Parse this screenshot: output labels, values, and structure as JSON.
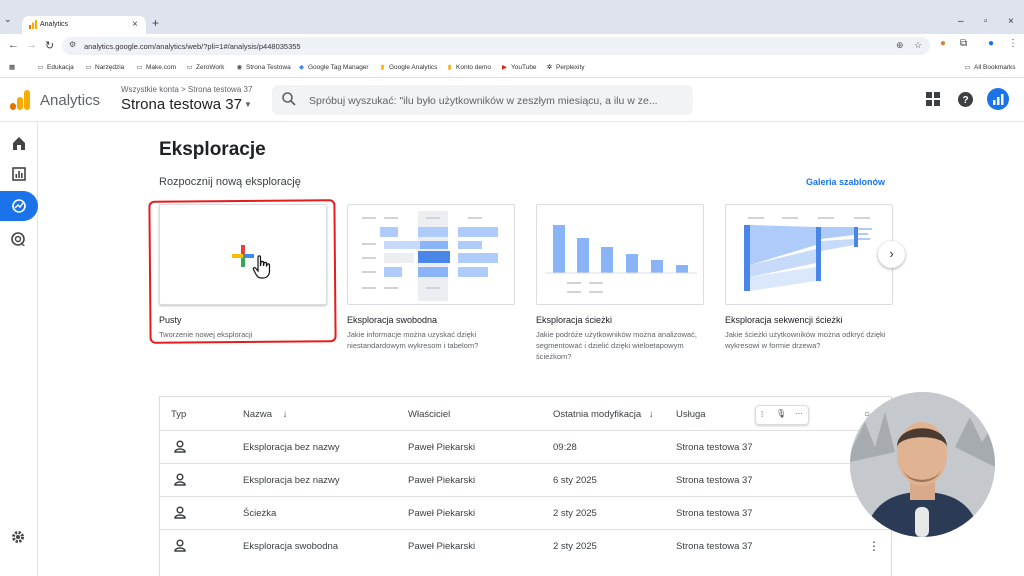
{
  "browser": {
    "tab_title": "Analytics",
    "url": "analytics.google.com/analytics/web/?pli=1#/analysis/p448035355",
    "new_tab": "+",
    "bookmarks": [
      "Edukacja",
      "Narzędzia",
      "Make.com",
      "ZeroWork",
      "Strona Testowa",
      "Google Tag Manager",
      "Google Analytics",
      "Konto demo",
      "YouTube",
      "Perplexity"
    ],
    "all_bookmarks": "All Bookmarks"
  },
  "header": {
    "app_name": "Analytics",
    "account_crumb": "Wszystkie konta > Strona testowa 37",
    "property_name": "Strona testowa 37",
    "search_placeholder": "Spróbuj wyszukać: \"ilu było użytkowników w zeszłym miesiącu, a ilu w ze..."
  },
  "main": {
    "title": "Eksploracje",
    "section_title": "Rozpocznij nową eksplorację",
    "gallery_link": "Galeria szablonów",
    "templates": [
      {
        "label": "Pusty",
        "desc": "Tworzenie nowej eksploracji"
      },
      {
        "label": "Eksploracja swobodna",
        "desc": "Jakie informacje można uzyskać dzięki niestandardowym wykresom i tabelom?"
      },
      {
        "label": "Eksploracja ścieżki",
        "desc": "Jakie podróże użytkowników można analizować, segmentować i dzielić dzięki wieloetapowym ścieżkom?"
      },
      {
        "label": "Eksploracja sekwencji ścieżki",
        "desc": "Jakie ścieżki użytkowników można odkryć dzięki wykresowi w formie drzewa?"
      }
    ]
  },
  "table": {
    "headers": {
      "type": "Typ",
      "name": "Nazwa",
      "owner": "Właściciel",
      "modified": "Ostatnia modyfikacja",
      "service": "Usługa"
    },
    "rows": [
      {
        "name": "Eksploracja bez nazwy",
        "owner": "Paweł Piekarski",
        "modified": "09:28",
        "service": "Strona testowa 37"
      },
      {
        "name": "Eksploracja bez nazwy",
        "owner": "Paweł Piekarski",
        "modified": "6 sty 2025",
        "service": "Strona testowa 37"
      },
      {
        "name": "Ścieżka",
        "owner": "Paweł Piekarski",
        "modified": "2 sty 2025",
        "service": "Strona testowa 37"
      },
      {
        "name": "Eksploracja swobodna",
        "owner": "Paweł Piekarski",
        "modified": "2 sty 2025",
        "service": "Strona testowa 37"
      }
    ]
  },
  "colors": {
    "accent": "#1a73e8",
    "highlight_box": "#e41c1c"
  }
}
